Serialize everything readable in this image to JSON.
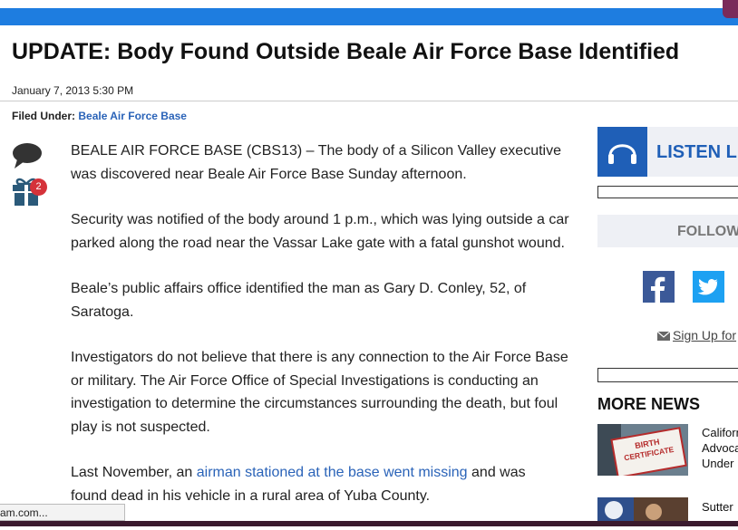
{
  "article": {
    "headline": "UPDATE: Body Found Outside Beale Air Force Base Identified",
    "date": "January 7, 2013 5:30 PM",
    "filed_under_label": "Filed Under:",
    "filed_under_link": "Beale Air Force Base",
    "gift_count": "2",
    "paragraphs": [
      "BEALE AIR FORCE BASE (CBS13) – The body of a Silicon Valley executive was discovered near Beale Air Force Base Sunday afternoon.",
      "Security was notified of the body around 1 p.m., which was lying outside a car parked along the road near the Vassar Lake gate with a fatal gunshot wound.",
      "Beale’s public affairs office identified the man as Gary D. Conley, 52, of Saratoga.",
      "Investigators do not believe that there is any connection to the Air Force Base or military. The Air Force Office of Special Investigations is conducting an investigation to determine the circumstances surrounding the death, but foul play is not suspected."
    ],
    "last_para": {
      "before": "Last November, an ",
      "link": "airman stationed at the base went missing",
      "after": " and was",
      "line2": "found dead in his vehicle in a rural area of Yuba County."
    }
  },
  "sidebar": {
    "listen_label": "LISTEN LIVE",
    "follow_label": "FOLLOW US",
    "signup_label": "Sign Up for",
    "more_news_label": "MORE NEWS",
    "news": [
      {
        "lines": [
          "Californ",
          "Advoca",
          "Under I"
        ],
        "thumb_caption": "BIRTH CERTIFICATE"
      },
      {
        "lines": [
          "Sutter"
        ]
      }
    ]
  },
  "status_bar": {
    "text": "am.com..."
  },
  "colors": {
    "accent": "#1e7de0",
    "link": "#2a63b8",
    "badge": "#d5323a"
  }
}
